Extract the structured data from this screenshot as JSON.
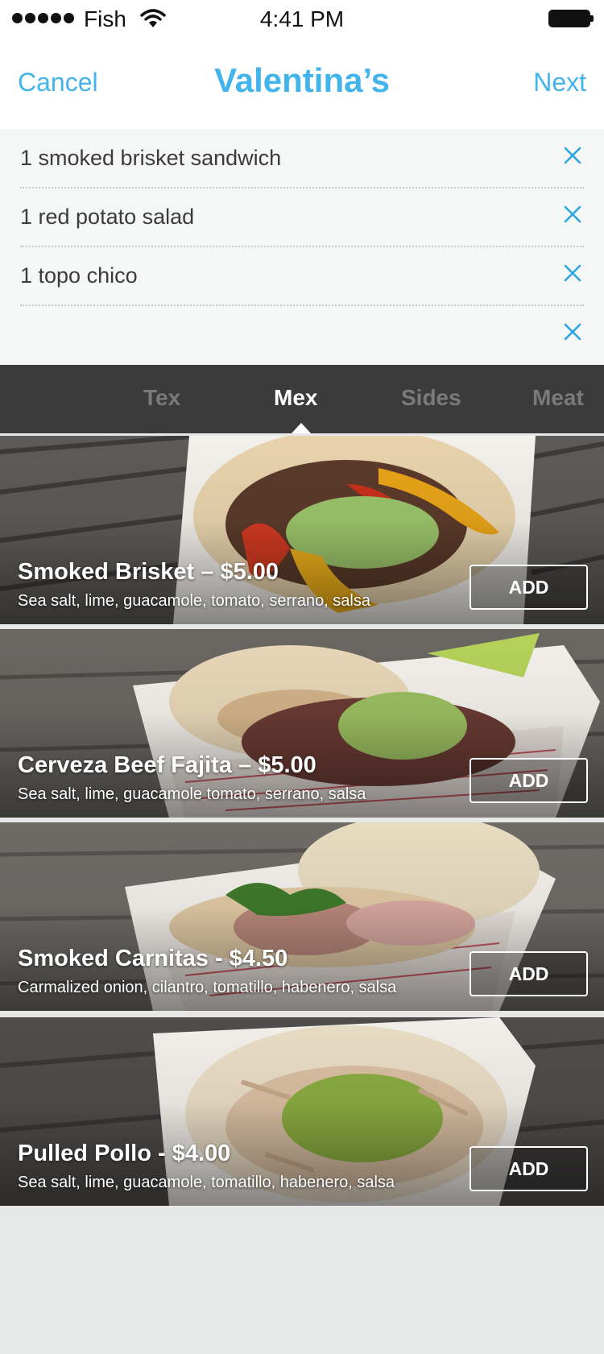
{
  "status_bar": {
    "carrier": "Fish",
    "time": "4:41 PM",
    "icons": [
      "signal-dots-icon",
      "wifi-icon",
      "battery-icon"
    ]
  },
  "nav": {
    "cancel_label": "Cancel",
    "title": "Valentina’s",
    "next_label": "Next",
    "accent_color": "#43b3ec"
  },
  "order": {
    "items": [
      {
        "label": "1 smoked brisket sandwich"
      },
      {
        "label": "1 red potato salad"
      },
      {
        "label": "1 topo chico"
      },
      {
        "label": ""
      }
    ],
    "remove_icon": "close-icon"
  },
  "tabs": {
    "items": [
      {
        "label": "Tex"
      },
      {
        "label": "Mex"
      },
      {
        "label": "Sides"
      },
      {
        "label": "Meat"
      }
    ],
    "active": "Mex"
  },
  "menu": {
    "items": [
      {
        "title": "Smoked Brisket – $5.00",
        "description": "Sea salt, lime, guacamole, tomato, serrano, salsa",
        "add_label": "ADD"
      },
      {
        "title": "Cerveza Beef Fajita – $5.00",
        "description": "Sea salt, lime, guacamole tomato, serrano, salsa",
        "add_label": "ADD"
      },
      {
        "title": "Smoked Carnitas - $4.50",
        "description": "Carmalized onion, cilantro, tomatillo, habenero, salsa",
        "add_label": "ADD"
      },
      {
        "title": "Pulled Pollo - $4.00",
        "description": "Sea salt, lime, guacamole, tomatillo, habenero, salsa",
        "add_label": "ADD"
      }
    ]
  }
}
